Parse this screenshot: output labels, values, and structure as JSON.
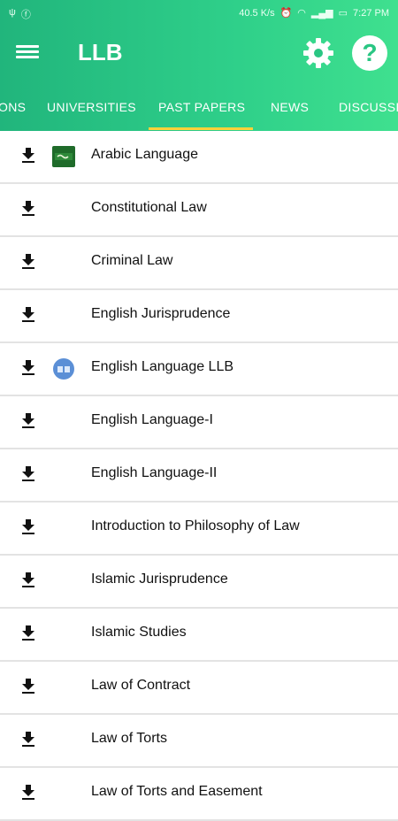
{
  "status": {
    "left_icons": [
      "usb-icon",
      "facebook-icon"
    ],
    "speed": "40.5 K/s",
    "time": "7:27 PM"
  },
  "toolbar": {
    "title": "LLB",
    "menu_icon": "hamburger-menu-icon",
    "settings_icon": "gear-icon",
    "help_icon": "help-icon"
  },
  "tabs": [
    {
      "label": "ONS"
    },
    {
      "label": "UNIVERSITIES"
    },
    {
      "label": "PAST PAPERS",
      "active": true
    },
    {
      "label": "NEWS"
    },
    {
      "label": "DISCUSSI"
    }
  ],
  "colors": {
    "accent": "#2ac683",
    "indicator": "#ffd23a"
  },
  "items": [
    {
      "label": "Arabic Language",
      "thumb": "arabic-book-icon"
    },
    {
      "label": "Constitutional Law"
    },
    {
      "label": "Criminal Law"
    },
    {
      "label": "English Jurisprudence"
    },
    {
      "label": "English Language LLB",
      "thumb": "english-book-icon"
    },
    {
      "label": "English Language-I"
    },
    {
      "label": "English Language-II"
    },
    {
      "label": "Introduction to Philosophy of Law"
    },
    {
      "label": "Islamic Jurisprudence"
    },
    {
      "label": "Islamic Studies"
    },
    {
      "label": "Law of Contract"
    },
    {
      "label": "Law of Torts"
    },
    {
      "label": "Law of Torts and Easement"
    }
  ]
}
